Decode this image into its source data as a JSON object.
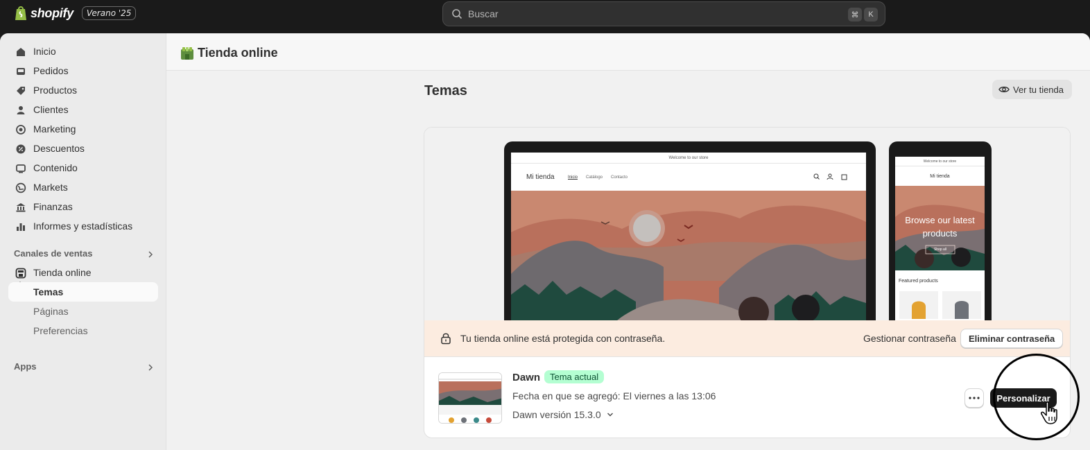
{
  "topbar": {
    "logo_text": "shopify",
    "season_badge": "Verano '25",
    "search_placeholder": "Buscar",
    "shortcut_keys": [
      "⌘",
      "K"
    ]
  },
  "sidebar": {
    "items": [
      {
        "label": "Inicio",
        "icon": "home-icon"
      },
      {
        "label": "Pedidos",
        "icon": "inbox-icon"
      },
      {
        "label": "Productos",
        "icon": "tag-icon"
      },
      {
        "label": "Clientes",
        "icon": "person-icon"
      },
      {
        "label": "Marketing",
        "icon": "target-icon"
      },
      {
        "label": "Descuentos",
        "icon": "discount-icon"
      },
      {
        "label": "Contenido",
        "icon": "content-icon"
      },
      {
        "label": "Markets",
        "icon": "globe-icon"
      },
      {
        "label": "Finanzas",
        "icon": "bank-icon"
      },
      {
        "label": "Informes y estadísticas",
        "icon": "chart-bar-icon"
      }
    ],
    "sales_channels_heading": "Canales de ventas",
    "online_store": {
      "label": "Tienda online",
      "subitems": [
        "Temas",
        "Páginas",
        "Preferencias"
      ]
    },
    "apps_heading": "Apps"
  },
  "page": {
    "store_title": "Tienda online",
    "section_title": "Temas",
    "view_store_button": "Ver tu tienda"
  },
  "preview": {
    "desktop": {
      "announcement": "Welcome to our store",
      "store_name": "Mi tienda",
      "nav_links": [
        "Inicio",
        "Catálogo",
        "Contacto"
      ]
    },
    "mobile": {
      "announcement": "Welcome to our store",
      "store_name": "Mi tienda",
      "hero_text": "Browse our latest products",
      "hero_button": "Shop all",
      "featured": "Featured products"
    }
  },
  "password_notice": {
    "text": "Tu tienda online está protegida con contraseña.",
    "manage_link": "Gestionar contraseña",
    "remove_button": "Eliminar contraseña"
  },
  "current_theme": {
    "name": "Dawn",
    "badge": "Tema actual",
    "added": "Fecha en que se agregó: El viernes a las 13:06",
    "version": "Dawn versión 15.3.0",
    "customize_button": "Personalizar"
  },
  "colors": {
    "topbar_bg": "#1a1a1a",
    "badge_green_bg": "#b4fed2",
    "notice_bg": "#fcece0",
    "brand_green": "#5e8e3e"
  }
}
